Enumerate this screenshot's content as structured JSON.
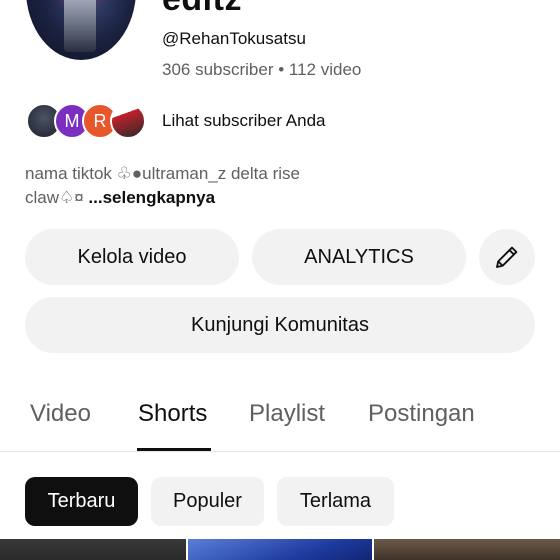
{
  "channel": {
    "name": "editz",
    "handle": "@RehanTokusatsu",
    "stats": "306 subscriber • 112 video"
  },
  "subscribers": {
    "avatars": [
      {
        "letter": ""
      },
      {
        "letter": "M",
        "color": "#7b2fbf"
      },
      {
        "letter": "R",
        "color": "#e8572b"
      },
      {
        "letter": ""
      }
    ],
    "label": "Lihat subscriber Anda"
  },
  "description": {
    "line1": "nama tiktok ♧●ultraman_z delta rise",
    "line2": "claw♤¤",
    "more": " ...selengkapnya"
  },
  "actions": {
    "manage_videos": "Kelola video",
    "analytics": "ANALYTICS",
    "edit_icon": "pencil-icon",
    "visit_community": "Kunjungi Komunitas"
  },
  "tabs": [
    "Video",
    "Shorts",
    "Playlist",
    "Postingan"
  ],
  "active_tab": "Shorts",
  "filters": [
    "Terbaru",
    "Populer",
    "Terlama"
  ],
  "active_filter": "Terbaru"
}
